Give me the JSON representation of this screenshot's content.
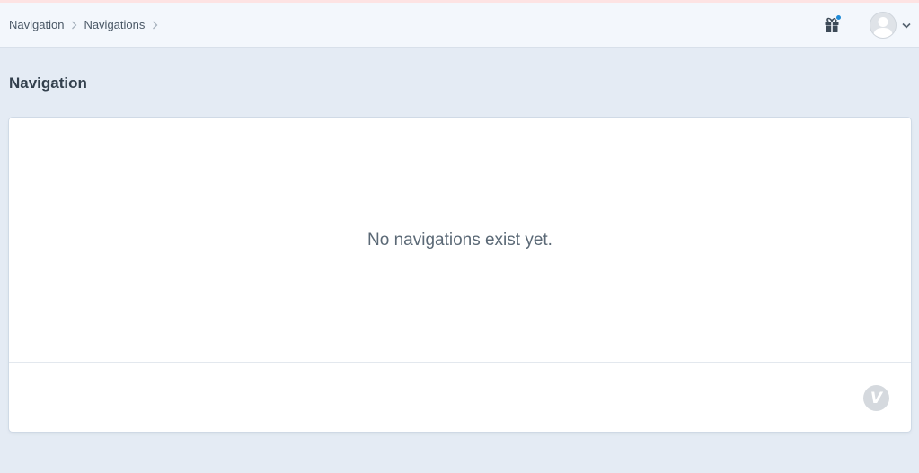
{
  "breadcrumb": {
    "items": [
      {
        "label": "Navigation"
      },
      {
        "label": "Navigations"
      }
    ]
  },
  "header": {
    "gift_icon": "gift-icon",
    "notification_dot_color": "#1f8ad6",
    "user_avatar_icon": "user-avatar-icon",
    "user_menu_icon": "chevron-down-icon"
  },
  "page": {
    "title": "Navigation"
  },
  "empty_state": {
    "message": "No navigations exist yet."
  },
  "footer": {
    "logo_letter": "V"
  },
  "colors": {
    "background": "#e4ebf4",
    "header_bg": "#f3f7fc",
    "top_accent": "#fde3e3",
    "card_bg": "#ffffff"
  }
}
